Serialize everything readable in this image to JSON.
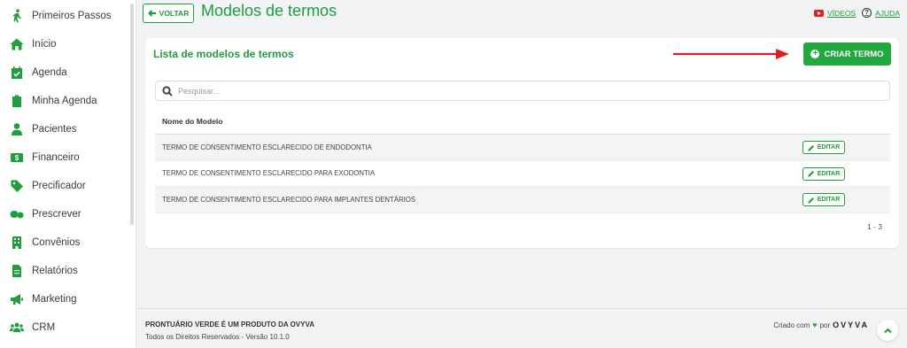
{
  "sidebar": {
    "items": [
      {
        "label": "Primeiros Passos",
        "icon": "walking-person-icon"
      },
      {
        "label": "Início",
        "icon": "home-icon"
      },
      {
        "label": "Agenda",
        "icon": "calendar-check-icon"
      },
      {
        "label": "Minha Agenda",
        "icon": "clipboard-icon"
      },
      {
        "label": "Pacientes",
        "icon": "user-icon"
      },
      {
        "label": "Financeiro",
        "icon": "money-icon"
      },
      {
        "label": "Precificador",
        "icon": "price-tag-icon"
      },
      {
        "label": "Prescrever",
        "icon": "pills-icon"
      },
      {
        "label": "Convênios",
        "icon": "building-icon"
      },
      {
        "label": "Relatórios",
        "icon": "document-icon"
      },
      {
        "label": "Marketing",
        "icon": "megaphone-icon"
      },
      {
        "label": "CRM",
        "icon": "users-group-icon"
      }
    ]
  },
  "header": {
    "back_label": "VOLTAR",
    "title": "Modelos de termos",
    "videos_label": "VÍDEOS",
    "help_label": "AJUDA",
    "help_glyph": "?"
  },
  "card": {
    "title": "Lista de modelos de termos",
    "create_label": "CRIAR TERMO",
    "search_placeholder": "Pesquisar...",
    "column_header": "Nome do Modelo",
    "rows": [
      {
        "name": "TERMO DE CONSENTIMENTO ESCLARECIDO DE ENDODONTIA",
        "action": "EDITAR"
      },
      {
        "name": "TERMO DE CONSENTIMENTO ESCLARECIDO PARA EXODONTIA",
        "action": "EDITAR"
      },
      {
        "name": "TERMO DE CONSENTIMENTO ESCLARECIDO PARA IMPLANTES DENTÁRIOS",
        "action": "EDITAR"
      }
    ],
    "pagination": "1 - 3"
  },
  "footer": {
    "product_line": "PRONTUÁRIO VERDE É UM PRODUTO DA OVYVA",
    "rights_line": "Todos os Direitos Reservados - Versão 10.1.0",
    "created_with": "Criado com",
    "heart": "♥",
    "by": "por",
    "brand": "OVYVA"
  },
  "colors": {
    "accent": "#1e9e3c",
    "button": "#22a83f",
    "arrow": "#e02020"
  }
}
